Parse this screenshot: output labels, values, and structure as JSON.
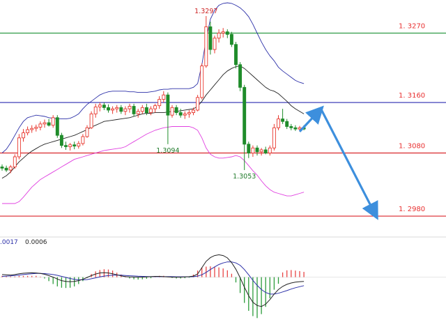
{
  "colors": {
    "bull": "#e8382f",
    "bear": "#1f8c2a",
    "band_upper": "#2b2fa8",
    "band_middle": "#222222",
    "band_lower": "#e040e0",
    "level_resistance_top": "#2e9b44",
    "level_blue": "#2a2ab0",
    "level_support": "#d9262a",
    "level_label": "#e83030",
    "annotation": "#1f7a2a",
    "arrow": "#3d8fdd",
    "macd_line": "#222222",
    "signal_line": "#2b2fa8",
    "hist_pos": "#e84545",
    "hist_neg": "#2b9b3a"
  },
  "price_panel": {
    "ylim": [
      1.2958,
      1.3318
    ],
    "levels": [
      {
        "value": 1.327,
        "label": "1. 3270",
        "color_key": "level_resistance_top"
      },
      {
        "value": 1.316,
        "label": "1. 3160",
        "color_key": "level_blue"
      },
      {
        "value": 1.308,
        "label": "1. 3080",
        "color_key": "level_support"
      },
      {
        "value": 1.298,
        "label": "1. 2980",
        "color_key": "level_support"
      }
    ],
    "annotations": [
      {
        "text": "1.3297",
        "index": 48,
        "value": 1.3297,
        "anchor": "top"
      },
      {
        "text": "1.3094",
        "index": 39,
        "value": 1.3094,
        "anchor": "bottom"
      },
      {
        "text": "1.3053",
        "index": 57,
        "value": 1.3053,
        "anchor": "bottom"
      }
    ]
  },
  "chart_data": {
    "type": "candlestick",
    "candles": [
      [
        1.3058,
        1.3062,
        1.3052,
        1.3056
      ],
      [
        1.3056,
        1.306,
        1.305,
        1.3053
      ],
      [
        1.3053,
        1.3061,
        1.3048,
        1.3058
      ],
      [
        1.3058,
        1.3078,
        1.3055,
        1.3074
      ],
      [
        1.3074,
        1.311,
        1.307,
        1.3104
      ],
      [
        1.3104,
        1.3118,
        1.3098,
        1.3112
      ],
      [
        1.3112,
        1.3122,
        1.3108,
        1.3117
      ],
      [
        1.3117,
        1.3124,
        1.3112,
        1.3119
      ],
      [
        1.3119,
        1.3125,
        1.3114,
        1.3121
      ],
      [
        1.3121,
        1.313,
        1.3116,
        1.3126
      ],
      [
        1.3126,
        1.3133,
        1.312,
        1.3128
      ],
      [
        1.3128,
        1.3134,
        1.3122,
        1.3124
      ],
      [
        1.3124,
        1.314,
        1.312,
        1.3136
      ],
      [
        1.3136,
        1.314,
        1.3104,
        1.3108
      ],
      [
        1.3108,
        1.3112,
        1.3088,
        1.3092
      ],
      [
        1.3092,
        1.3098,
        1.3085,
        1.309
      ],
      [
        1.309,
        1.3096,
        1.3084,
        1.3093
      ],
      [
        1.3093,
        1.3098,
        1.3086,
        1.3091
      ],
      [
        1.3091,
        1.3099,
        1.3087,
        1.3095
      ],
      [
        1.3095,
        1.311,
        1.3092,
        1.3106
      ],
      [
        1.3106,
        1.3124,
        1.3104,
        1.312
      ],
      [
        1.312,
        1.3146,
        1.3118,
        1.3142
      ],
      [
        1.3142,
        1.3158,
        1.3136,
        1.3153
      ],
      [
        1.3153,
        1.316,
        1.3146,
        1.3156
      ],
      [
        1.3156,
        1.316,
        1.3148,
        1.3152
      ],
      [
        1.3152,
        1.3157,
        1.3144,
        1.3148
      ],
      [
        1.3148,
        1.3154,
        1.3142,
        1.315
      ],
      [
        1.315,
        1.3156,
        1.3144,
        1.3152
      ],
      [
        1.3152,
        1.3156,
        1.3142,
        1.3146
      ],
      [
        1.3146,
        1.3154,
        1.314,
        1.315
      ],
      [
        1.315,
        1.3158,
        1.3144,
        1.3154
      ],
      [
        1.3154,
        1.3158,
        1.3138,
        1.3142
      ],
      [
        1.3142,
        1.315,
        1.3136,
        1.3146
      ],
      [
        1.3146,
        1.3156,
        1.3142,
        1.3152
      ],
      [
        1.3152,
        1.3158,
        1.314,
        1.3144
      ],
      [
        1.3144,
        1.3154,
        1.314,
        1.315
      ],
      [
        1.315,
        1.3158,
        1.3144,
        1.3155
      ],
      [
        1.3155,
        1.317,
        1.315,
        1.3165
      ],
      [
        1.3165,
        1.3178,
        1.316,
        1.3172
      ],
      [
        1.3172,
        1.3176,
        1.3094,
        1.314
      ],
      [
        1.314,
        1.3156,
        1.3136,
        1.3152
      ],
      [
        1.3152,
        1.3156,
        1.314,
        1.3144
      ],
      [
        1.3144,
        1.315,
        1.3136,
        1.314
      ],
      [
        1.314,
        1.3146,
        1.3134,
        1.3142
      ],
      [
        1.3142,
        1.3148,
        1.3136,
        1.3144
      ],
      [
        1.3144,
        1.3152,
        1.314,
        1.3148
      ],
      [
        1.3148,
        1.3172,
        1.3146,
        1.3168
      ],
      [
        1.3168,
        1.3222,
        1.3165,
        1.3218
      ],
      [
        1.3218,
        1.3297,
        1.3215,
        1.328
      ],
      [
        1.328,
        1.3288,
        1.3236,
        1.3244
      ],
      [
        1.3244,
        1.3266,
        1.3238,
        1.3262
      ],
      [
        1.3262,
        1.3276,
        1.3255,
        1.327
      ],
      [
        1.327,
        1.3278,
        1.3263,
        1.3272
      ],
      [
        1.3272,
        1.3276,
        1.3262,
        1.3268
      ],
      [
        1.3268,
        1.3272,
        1.3248,
        1.3252
      ],
      [
        1.3252,
        1.3256,
        1.3214,
        1.322
      ],
      [
        1.322,
        1.3224,
        1.3178,
        1.3184
      ],
      [
        1.3184,
        1.3188,
        1.3053,
        1.3094
      ],
      [
        1.3094,
        1.3098,
        1.3072,
        1.308
      ],
      [
        1.308,
        1.3092,
        1.3074,
        1.3088
      ],
      [
        1.3088,
        1.3092,
        1.3076,
        1.3082
      ],
      [
        1.3082,
        1.3088,
        1.3076,
        1.3085
      ],
      [
        1.3085,
        1.309,
        1.3078,
        1.308
      ],
      [
        1.308,
        1.3092,
        1.3076,
        1.3088
      ],
      [
        1.3088,
        1.3126,
        1.3084,
        1.312
      ],
      [
        1.312,
        1.314,
        1.3116,
        1.3134
      ],
      [
        1.3134,
        1.315,
        1.3126,
        1.313
      ],
      [
        1.313,
        1.3134,
        1.3118,
        1.3122
      ],
      [
        1.3122,
        1.3126,
        1.3116,
        1.312
      ],
      [
        1.312,
        1.3124,
        1.3115,
        1.3118
      ],
      [
        1.3118,
        1.3123,
        1.3114,
        1.312
      ],
      [
        1.312,
        1.3124,
        1.3116,
        1.3118
      ]
    ],
    "bands": {
      "upper": [
        1.308,
        1.3086,
        1.3096,
        1.3108,
        1.312,
        1.313,
        1.3136,
        1.3138,
        1.314,
        1.3139,
        1.3138,
        1.3136,
        1.3135,
        1.3134,
        1.3134,
        1.3134,
        1.3135,
        1.3138,
        1.3142,
        1.315,
        1.3157,
        1.3162,
        1.3167,
        1.3172,
        1.3175,
        1.3177,
        1.3178,
        1.3178,
        1.3178,
        1.3178,
        1.3177,
        1.3177,
        1.3176,
        1.3176,
        1.3176,
        1.3177,
        1.3178,
        1.318,
        1.3181,
        1.3181,
        1.3182,
        1.3182,
        1.3182,
        1.3182,
        1.3182,
        1.3184,
        1.319,
        1.322,
        1.326,
        1.3292,
        1.3306,
        1.3314,
        1.3317,
        1.3318,
        1.3317,
        1.3314,
        1.331,
        1.3304,
        1.3296,
        1.3284,
        1.327,
        1.3256,
        1.3244,
        1.3234,
        1.3226,
        1.3216,
        1.321,
        1.3205,
        1.32,
        1.3195,
        1.3192,
        1.319
      ],
      "middle": [
        1.304,
        1.3044,
        1.305,
        1.3058,
        1.3066,
        1.3072,
        1.3078,
        1.3083,
        1.3087,
        1.3091,
        1.3094,
        1.3096,
        1.3098,
        1.31,
        1.3102,
        1.3104,
        1.3106,
        1.3108,
        1.3111,
        1.3114,
        1.3117,
        1.3121,
        1.3124,
        1.3127,
        1.313,
        1.3131,
        1.3132,
        1.3133,
        1.3134,
        1.3135,
        1.3136,
        1.3138,
        1.314,
        1.3142,
        1.3143,
        1.3143,
        1.3144,
        1.3144,
        1.3144,
        1.3145,
        1.3146,
        1.3146,
        1.3147,
        1.3148,
        1.3149,
        1.315,
        1.3154,
        1.3162,
        1.3172,
        1.318,
        1.3188,
        1.3196,
        1.3204,
        1.321,
        1.3214,
        1.3217,
        1.3218,
        1.3214,
        1.3208,
        1.3202,
        1.3196,
        1.319,
        1.3184,
        1.318,
        1.3178,
        1.3174,
        1.3168,
        1.3162,
        1.3155,
        1.315,
        1.3146,
        1.3142
      ],
      "lower": [
        1.3,
        1.3,
        1.3,
        1.3,
        1.3003,
        1.301,
        1.3018,
        1.3026,
        1.3032,
        1.3038,
        1.3042,
        1.3046,
        1.305,
        1.3054,
        1.3058,
        1.3062,
        1.3066,
        1.307,
        1.3072,
        1.3074,
        1.3076,
        1.3078,
        1.308,
        1.3082,
        1.3084,
        1.3085,
        1.3086,
        1.3087,
        1.3088,
        1.309,
        1.3094,
        1.3098,
        1.3102,
        1.3106,
        1.311,
        1.3113,
        1.3116,
        1.3118,
        1.312,
        1.3121,
        1.3122,
        1.3122,
        1.3122,
        1.3122,
        1.3122,
        1.312,
        1.3116,
        1.3104,
        1.3088,
        1.3078,
        1.3074,
        1.3072,
        1.3072,
        1.3073,
        1.3074,
        1.3076,
        1.3074,
        1.3068,
        1.306,
        1.3052,
        1.3045,
        1.3036,
        1.3028,
        1.3022,
        1.3018,
        1.3016,
        1.3014,
        1.3012,
        1.3012,
        1.3014,
        1.3016,
        1.3018
      ]
    },
    "forecast_path": [
      {
        "index": 70,
        "value": 1.3114
      },
      {
        "index": 75,
        "value": 1.315
      },
      {
        "index": 88,
        "value": 1.298
      }
    ]
  },
  "macd_panel": {
    "labels": [
      ".0017",
      "0.0006"
    ],
    "ylim": [
      -0.0034,
      0.0022
    ],
    "macd": [
      0.0002,
      0.00018,
      0.00016,
      0.0002,
      0.00026,
      0.0003,
      0.00032,
      0.00033,
      0.00032,
      0.00028,
      0.00022,
      0.00012,
      0.0,
      -0.00014,
      -0.00026,
      -0.00032,
      -0.00034,
      -0.00032,
      -0.00026,
      -0.00016,
      -2e-05,
      0.00012,
      0.00024,
      0.00032,
      0.00034,
      0.00032,
      0.00026,
      0.00018,
      0.0001,
      4e-05,
      2e-05,
      1e-05,
      0.0,
      0.0,
      2e-05,
      4e-05,
      6e-05,
      6e-05,
      4e-05,
      2e-05,
      0.0,
      0.0,
      0.0,
      2e-05,
      4e-05,
      8e-05,
      0.00024,
      0.00072,
      0.0012,
      0.00148,
      0.00164,
      0.0017,
      0.00164,
      0.00146,
      0.0011,
      0.0006,
      -4e-05,
      -0.00076,
      -0.0014,
      -0.0019,
      -0.00215,
      -0.00222,
      -0.00205,
      -0.0017,
      -0.00128,
      -0.00094,
      -0.0007,
      -0.00054,
      -0.00044,
      -0.00038,
      -0.00034,
      -0.00032
    ],
    "signal": [
      6e-05,
      8e-05,
      0.0001,
      0.00013,
      0.00016,
      0.0002,
      0.00023,
      0.00026,
      0.00028,
      0.00028,
      0.00027,
      0.00024,
      0.0002,
      0.00014,
      6e-05,
      -2e-05,
      -0.0001,
      -0.00016,
      -0.0002,
      -0.0002,
      -0.00018,
      -0.00012,
      -5e-05,
      2e-05,
      8e-05,
      0.00012,
      0.00015,
      0.00016,
      0.00015,
      0.00013,
      0.00011,
      9e-05,
      7e-05,
      6e-05,
      5e-05,
      4e-05,
      4e-05,
      4e-05,
      4e-05,
      4e-05,
      4e-05,
      3e-05,
      3e-05,
      3e-05,
      3e-05,
      4e-05,
      8e-05,
      0.00018,
      0.00036,
      0.00058,
      0.00078,
      0.00096,
      0.00108,
      0.00116,
      0.00116,
      0.00108,
      0.0009,
      0.00058,
      0.00018,
      -0.00024,
      -0.00062,
      -0.00094,
      -0.00116,
      -0.00128,
      -0.00128,
      -0.00122,
      -0.00112,
      -0.00102,
      -0.0009,
      -0.0008,
      -0.00072,
      -0.00064
    ],
    "hist": [
      0.0001,
      8e-05,
      6e-05,
      5e-05,
      0.0001,
      0.0001,
      0.0001,
      0.0001,
      0.0001,
      4e-05,
      -0.0001,
      -0.0003,
      -0.00052,
      -0.0007,
      -0.0008,
      -0.00082,
      -0.0008,
      -0.0007,
      -0.00052,
      -0.0003,
      -6e-05,
      0.00024,
      0.00044,
      0.00054,
      0.0006,
      0.00058,
      0.0005,
      0.00034,
      0.0002,
      8e-05,
      -0.0001,
      -0.00016,
      -0.00018,
      -0.00016,
      -0.00012,
      -8e-05,
      4e-05,
      0.0001,
      0.0001,
      4e-05,
      -6e-05,
      -0.0001,
      -0.0001,
      -8e-05,
      -4e-05,
      0.0002,
      0.0005,
      0.00074,
      0.0008,
      0.00082,
      0.0008,
      0.00074,
      0.00066,
      0.00052,
      0.00026,
      -0.0004,
      -0.0012,
      -0.00195,
      -0.00255,
      -0.00295,
      -0.0031,
      -0.0028,
      -0.00225,
      -0.0016,
      -0.00095,
      -0.0005,
      0.00036,
      0.00052,
      0.00054,
      0.0005,
      0.00046,
      0.0004
    ]
  }
}
